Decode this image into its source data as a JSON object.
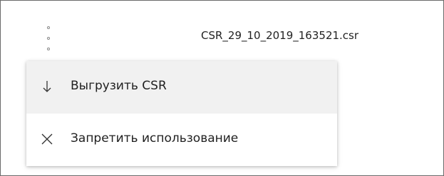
{
  "row": {
    "kebab_icon": "more-vertical-icon",
    "filename": "CSR_29_10_2019_163521.csr"
  },
  "menu": {
    "items": [
      {
        "label": "Выгрузить CSR",
        "icon": "download-arrow-icon"
      },
      {
        "label": "Запретить использование",
        "icon": "close-x-icon"
      }
    ]
  },
  "colors": {
    "hover_bg": "#f1f1f1",
    "text": "#1f1f1f",
    "border": "#6a6a6a"
  }
}
